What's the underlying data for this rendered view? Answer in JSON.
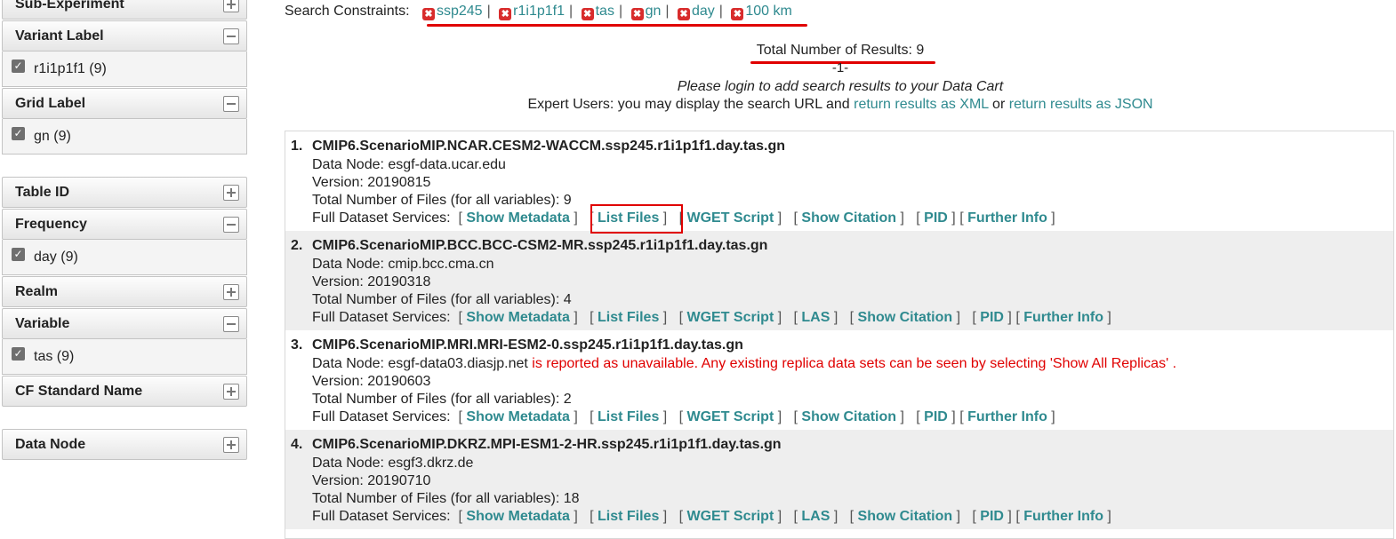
{
  "sidebar": {
    "facets": [
      {
        "label": "Sub-Experiment",
        "state": "collapsed"
      },
      {
        "label": "Variant Label",
        "state": "expanded",
        "option": "r1i1p1f1 (9)"
      },
      {
        "label": "Grid Label",
        "state": "expanded",
        "option": "gn (9)"
      },
      {
        "label": "Table ID",
        "state": "collapsed"
      },
      {
        "label": "Frequency",
        "state": "expanded",
        "option": "day (9)"
      },
      {
        "label": "Realm",
        "state": "collapsed"
      },
      {
        "label": "Variable",
        "state": "expanded",
        "option": "tas (9)"
      },
      {
        "label": "CF Standard Name",
        "state": "collapsed"
      },
      {
        "label": "Data Node",
        "state": "collapsed"
      }
    ]
  },
  "main": {
    "constraints_label": "Search Constraints:",
    "constraints": [
      "ssp245",
      "r1i1p1f1",
      "tas",
      "gn",
      "day",
      "100 km"
    ],
    "total_results": "Total Number of Results: 9",
    "page": "-1-",
    "login_msg": "Please login to add search results to your Data Cart",
    "expert_prefix": "Expert Users: you may display the search URL and",
    "xml_link": "return results as XML",
    "or": "or",
    "json_link": "return results as JSON"
  },
  "results": [
    {
      "num": "1.",
      "title": "CMIP6.ScenarioMIP.NCAR.CESM2-WACCM.ssp245.r1i1p1f1.day.tas.gn",
      "data_node": "Data Node: esgf-data.ucar.edu",
      "version": "Version: 20190815",
      "files": "Total Number of Files (for all variables): 9"
    },
    {
      "num": "2.",
      "title": "CMIP6.ScenarioMIP.BCC.BCC-CSM2-MR.ssp245.r1i1p1f1.day.tas.gn",
      "data_node": "Data Node: cmip.bcc.cma.cn",
      "version": "Version: 20190318",
      "files": "Total Number of Files (for all variables): 4"
    },
    {
      "num": "3.",
      "title": "CMIP6.ScenarioMIP.MRI.MRI-ESM2-0.ssp245.r1i1p1f1.day.tas.gn",
      "data_node": "Data Node: esgf-data03.diasjp.net",
      "warning": "is reported as unavailable. Any existing replica data sets can be seen by selecting 'Show All Replicas' .",
      "version": "Version: 20190603",
      "files": "Total Number of Files (for all variables): 2"
    },
    {
      "num": "4.",
      "title": "CMIP6.ScenarioMIP.DKRZ.MPI-ESM1-2-HR.ssp245.r1i1p1f1.day.tas.gn",
      "data_node": "Data Node: esgf3.dkrz.de",
      "version": "Version: 20190710",
      "files": "Total Number of Files (for all variables): 18"
    }
  ],
  "services": {
    "label": "Full Dataset Services:",
    "show_metadata": "Show Metadata",
    "list_files": "List Files",
    "wget": "WGET Script",
    "las": "LAS",
    "citation": "Show Citation",
    "pid": "PID",
    "further_info": "Further Info"
  },
  "colors": {
    "link": "#2f8a8f",
    "highlight": "#e00000",
    "warning": "#e00000"
  }
}
